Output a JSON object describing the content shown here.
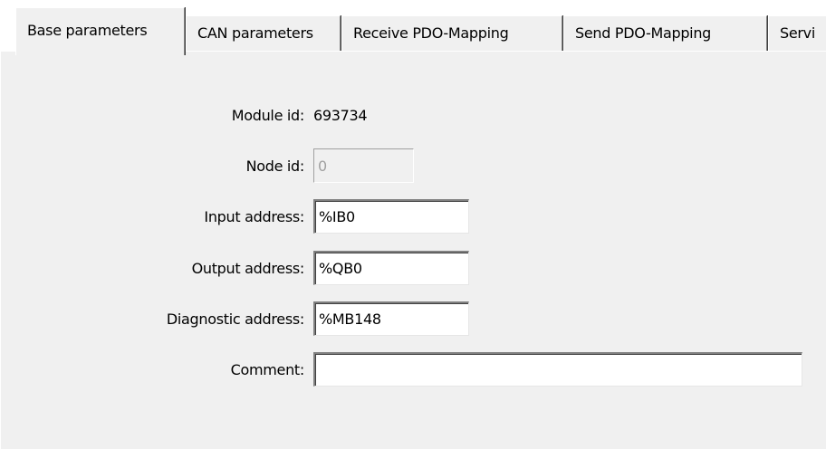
{
  "tabs": [
    {
      "label": "Base parameters",
      "active": true
    },
    {
      "label": "CAN parameters",
      "active": false
    },
    {
      "label": "Receive PDO-Mapping",
      "active": false
    },
    {
      "label": "Send PDO-Mapping",
      "active": false
    },
    {
      "label": "Servi",
      "active": false
    }
  ],
  "form": {
    "module_id": {
      "label": "Module id:",
      "value": "693734"
    },
    "node_id": {
      "label": "Node id:",
      "value": "0",
      "disabled": true
    },
    "input_address": {
      "label": "Input address:",
      "value": "%IB0"
    },
    "output_address": {
      "label": "Output address:",
      "value": "%QB0"
    },
    "diagnostic_address": {
      "label": "Diagnostic address:",
      "value": "%MB148"
    },
    "comment": {
      "label": "Comment:",
      "value": ""
    }
  },
  "colors": {
    "face": "#f0f0f0",
    "highlight": "#ffffff",
    "shadow": "#808080",
    "dark_shadow": "#404040",
    "disabled_text": "#a0a0a0"
  }
}
